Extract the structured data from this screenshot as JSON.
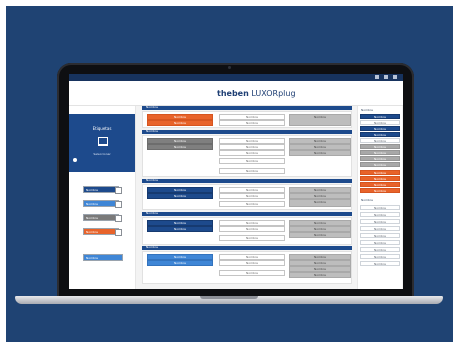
{
  "app": {
    "brand_bold": "theben",
    "brand_rest": " LUXORplug"
  },
  "sidebar": {
    "card_title": "Etiquetas",
    "card_sub": "Seleccionar",
    "buttons": [
      {
        "label": "Nombre",
        "color": "#1d4a8c"
      },
      {
        "label": "Nombre",
        "color": "#3f86d6"
      },
      {
        "label": "Nombre",
        "color": "#7a7a7a"
      },
      {
        "label": "Nombre",
        "color": "#e8632a"
      },
      {
        "label": "Nombre",
        "color": "#3f86d6"
      }
    ]
  },
  "sections": [
    {
      "label": "Nombre",
      "row1": "Nombre",
      "row2": "Nombre"
    },
    {
      "label": "Nombre",
      "row1": "Nombre",
      "row2": "Nombre"
    },
    {
      "label": "Nombre",
      "row1": "Nombre",
      "row2": "Nombre"
    },
    {
      "label": "Nombre",
      "row1": "Nombre",
      "row2": "Nombre"
    },
    {
      "label": "Nombre",
      "row1": "Nombre",
      "row2": "Nombre"
    }
  ],
  "right_panel": {
    "items": [
      "Nombre",
      "Nombre",
      "Nombre",
      "Nombre",
      "Nombre",
      "Nombre",
      "Nombre",
      "Nombre",
      "Nombre",
      "Nombre",
      "Nombre",
      "Nombre",
      "Nombre",
      "Nombre",
      "Nombre",
      "Nombre",
      "Nombre",
      "Nombre",
      "Nombre",
      "Nombre",
      "Nombre",
      "Nombre",
      "Nombre",
      "Nombre"
    ]
  },
  "colors": {
    "brand_blue": "#1d4a8c",
    "accent_orange": "#e8632a",
    "background": "#1f4373"
  }
}
